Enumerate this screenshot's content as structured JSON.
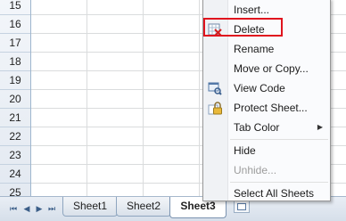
{
  "rows": [
    "15",
    "16",
    "17",
    "18",
    "19",
    "20",
    "21",
    "22",
    "23",
    "24",
    "25"
  ],
  "sheet_nav": {
    "first": "⏮",
    "prev": "◀",
    "next": "▶",
    "last": "⏭"
  },
  "sheet_tabs": [
    {
      "label": "Sheet1",
      "active": false
    },
    {
      "label": "Sheet2",
      "active": false
    },
    {
      "label": "Sheet3",
      "active": true
    }
  ],
  "context_menu": {
    "insert": "Insert...",
    "delete": "Delete",
    "rename": "Rename",
    "move_copy": "Move or Copy...",
    "view_code": "View Code",
    "protect_sheet": "Protect Sheet...",
    "tab_color": "Tab Color",
    "hide": "Hide",
    "unhide": "Unhide...",
    "select_all": "Select All Sheets"
  },
  "highlight_color": "#e0141e"
}
